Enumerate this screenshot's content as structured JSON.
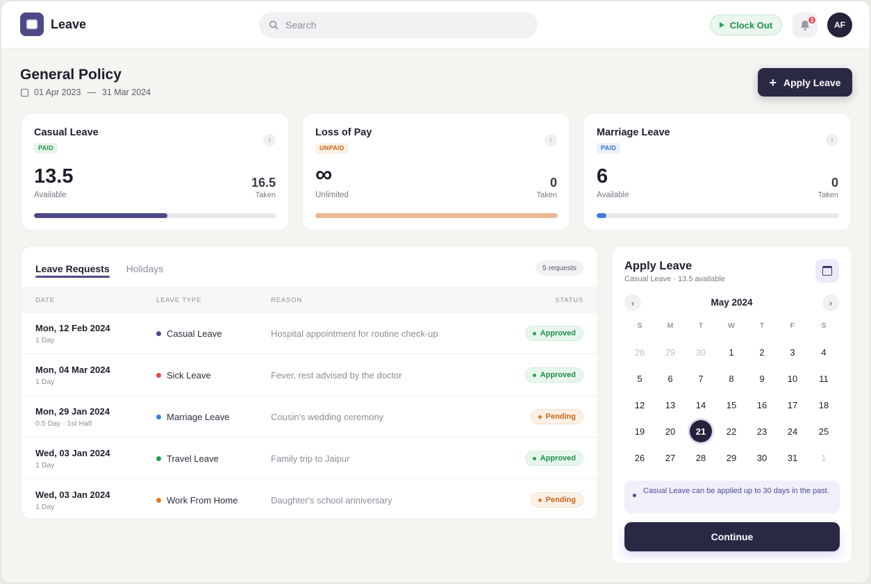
{
  "app": {
    "title": "Leave"
  },
  "search": {
    "placeholder": "Search"
  },
  "header": {
    "clock_label": "Clock Out",
    "notification_count": "3",
    "avatar_initials": "AF"
  },
  "policy": {
    "title": "General Policy",
    "start_date": "01 Apr 2023",
    "separator": "—",
    "end_date": "31 Mar 2024",
    "apply_label": "Apply Leave"
  },
  "cards": [
    {
      "title": "Casual Leave",
      "badge": "PAID",
      "info": "i",
      "value": "13.5",
      "value_label": "Available",
      "taken": "16.5",
      "taken_label": "Taken",
      "progress": 0.55,
      "color": "#4c4a86",
      "badge_bg": "#e7f6ec",
      "badge_fg": "#1f8f4a"
    },
    {
      "title": "Loss of Pay",
      "badge": "UNPAID",
      "info": "i",
      "value": "∞",
      "value_label": "Unlimited",
      "taken": "0",
      "taken_label": "Taken",
      "progress": 1.0,
      "color": "#eab894",
      "badge_bg": "#fdf0e5",
      "badge_fg": "#c8661d"
    },
    {
      "title": "Marriage Leave",
      "badge": "PAID",
      "info": "i",
      "value": "6",
      "value_label": "Available",
      "taken": "0",
      "taken_label": "Taken",
      "progress": 0.04,
      "color": "#3b7ddd",
      "badge_bg": "#e8f0fc",
      "badge_fg": "#3b6fc4"
    }
  ],
  "requests": {
    "tabs": [
      "Leave Requests",
      "Holidays"
    ],
    "count_label": "5 requests",
    "columns": [
      "DATE",
      "LEAVE TYPE",
      "REASON",
      "STATUS"
    ],
    "rows": [
      {
        "date": "Mon, 12 Feb 2024",
        "duration": "1 Day",
        "type": "Casual Leave",
        "dot": "#4c4a86",
        "reason": "Hospital appointment for routine check-up",
        "status": "Approved",
        "status_kind": "approved"
      },
      {
        "date": "Mon, 04 Mar 2024",
        "duration": "1 Day",
        "type": "Sick Leave",
        "dot": "#e5484d",
        "reason": "Fever, rest advised by the doctor",
        "status": "Approved",
        "status_kind": "approved"
      },
      {
        "date": "Mon, 29 Jan 2024",
        "duration": "0.5 Day · 1st Half",
        "type": "Marriage Leave",
        "dot": "#3b7ddd",
        "reason": "Cousin's wedding ceremony",
        "status": "Pending",
        "status_kind": "pending"
      },
      {
        "date": "Wed, 03 Jan 2024",
        "duration": "1 Day",
        "type": "Travel Leave",
        "dot": "#22a352",
        "reason": "Family trip to Jaipur",
        "status": "Approved",
        "status_kind": "approved"
      },
      {
        "date": "Wed, 03 Jan 2024",
        "duration": "1 Day",
        "type": "Work From Home",
        "dot": "#e0782d",
        "reason": "Daughter's school anniversary",
        "status": "Pending",
        "status_kind": "pending"
      }
    ]
  },
  "apply_panel": {
    "title": "Apply Leave",
    "subtitle": "Casual Leave · 13.5 available",
    "prev": "‹",
    "next": "›",
    "month": "May 2024",
    "weekdays": [
      "S",
      "M",
      "T",
      "W",
      "T",
      "F",
      "S"
    ],
    "weeks": [
      [
        {
          "d": "28",
          "m": true
        },
        {
          "d": "29",
          "m": true
        },
        {
          "d": "30",
          "m": true
        },
        {
          "d": "1"
        },
        {
          "d": "2"
        },
        {
          "d": "3"
        },
        {
          "d": "4"
        }
      ],
      [
        {
          "d": "5"
        },
        {
          "d": "6"
        },
        {
          "d": "7"
        },
        {
          "d": "8"
        },
        {
          "d": "9"
        },
        {
          "d": "10"
        },
        {
          "d": "11"
        }
      ],
      [
        {
          "d": "12"
        },
        {
          "d": "13"
        },
        {
          "d": "14"
        },
        {
          "d": "15"
        },
        {
          "d": "16"
        },
        {
          "d": "17"
        },
        {
          "d": "18"
        }
      ],
      [
        {
          "d": "19"
        },
        {
          "d": "20"
        },
        {
          "d": "21",
          "s": true
        },
        {
          "d": "22"
        },
        {
          "d": "23"
        },
        {
          "d": "24"
        },
        {
          "d": "25"
        }
      ],
      [
        {
          "d": "26"
        },
        {
          "d": "27"
        },
        {
          "d": "28"
        },
        {
          "d": "29"
        },
        {
          "d": "30"
        },
        {
          "d": "31"
        },
        {
          "d": "1",
          "m": true
        }
      ]
    ],
    "note": "Casual Leave can be applied up to 30 days in the past.",
    "continue_label": "Continue"
  }
}
